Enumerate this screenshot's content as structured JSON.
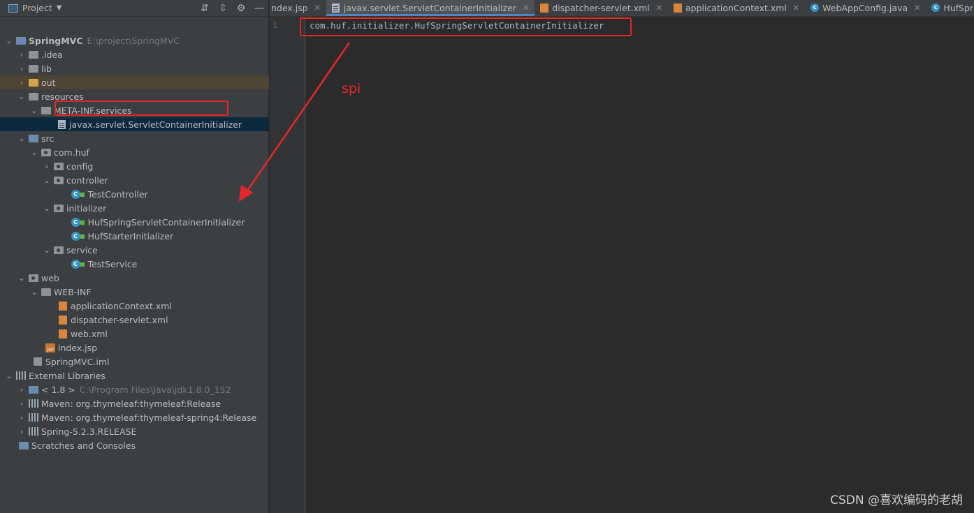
{
  "panel": {
    "title": "Project"
  },
  "tree": [
    {
      "label": "SpringMVC",
      "path": "E:\\project\\SpringMVC"
    },
    {
      "label": ".idea"
    },
    {
      "label": "lib"
    },
    {
      "label": "out"
    },
    {
      "label": "resources"
    },
    {
      "label": "META-INF.services"
    },
    {
      "label": "javax.servlet.ServletContainerInitializer"
    },
    {
      "label": "src"
    },
    {
      "label": "com.huf"
    },
    {
      "label": "config"
    },
    {
      "label": "controller"
    },
    {
      "label": "TestController"
    },
    {
      "label": "initializer"
    },
    {
      "label": "HufSpringServletContainerInitializer"
    },
    {
      "label": "HufStarterInitializer"
    },
    {
      "label": "service"
    },
    {
      "label": "TestService"
    },
    {
      "label": "web"
    },
    {
      "label": "WEB-INF"
    },
    {
      "label": "applicationContext.xml"
    },
    {
      "label": "dispatcher-servlet.xml"
    },
    {
      "label": "web.xml"
    },
    {
      "label": "index.jsp"
    },
    {
      "label": "SpringMVC.iml"
    },
    {
      "label": "External Libraries"
    },
    {
      "label": "< 1.8 >",
      "path": "C:\\Program Files\\Java\\jdk1.8.0_152"
    },
    {
      "label": "Maven: org.thymeleaf:thymeleaf:Release"
    },
    {
      "label": "Maven: org.thymeleaf:thymeleaf-spring4:Release"
    },
    {
      "label": "Spring-5.2.3.RELEASE"
    },
    {
      "label": "Scratches and Consoles"
    }
  ],
  "tabs": [
    {
      "label": "ndex.jsp"
    },
    {
      "label": "javax.servlet.ServletContainerInitializer"
    },
    {
      "label": "dispatcher-servlet.xml"
    },
    {
      "label": "applicationContext.xml"
    },
    {
      "label": "WebAppConfig.java"
    },
    {
      "label": "HufSpringServletCo"
    }
  ],
  "editor": {
    "line_number": "1",
    "code_line": "com.huf.initializer.HufSpringServletContainerInitializer"
  },
  "annotation": {
    "text": "spi"
  },
  "watermark": "CSDN @喜欢编码的老胡",
  "colors": {
    "annotation": "#e8262a",
    "selection": "#0d293e",
    "accent": "#4a88c7"
  }
}
